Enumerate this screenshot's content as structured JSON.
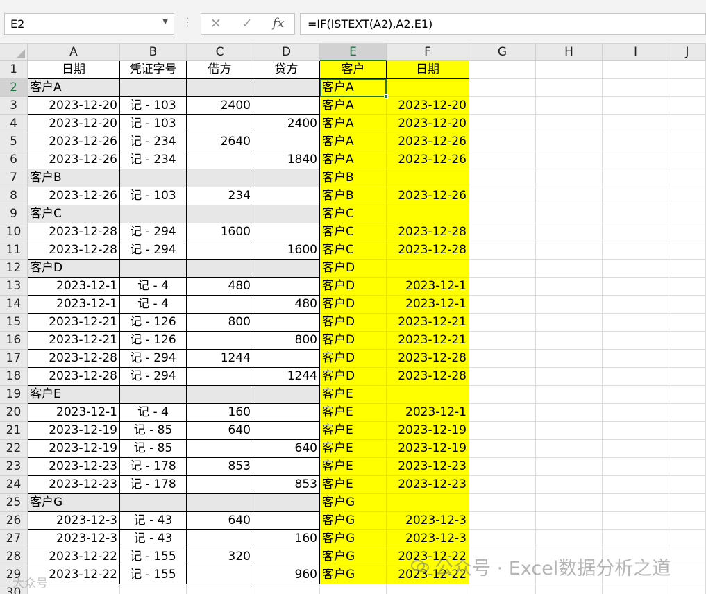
{
  "formula_bar": {
    "name_box": "E2",
    "formula": "=IF(ISTEXT(A2),A2,E1)"
  },
  "columns": [
    "A",
    "B",
    "C",
    "D",
    "E",
    "F",
    "G",
    "H",
    "I",
    "J"
  ],
  "selected_cell": "E2",
  "sheet": {
    "headers": [
      "日期",
      "凭证字号",
      "借方",
      "贷方",
      "客户",
      "日期"
    ],
    "rows": [
      {
        "row": 2,
        "group": true,
        "a": "客户A",
        "b": "",
        "c": "",
        "d": "",
        "e": "客户A",
        "f": ""
      },
      {
        "row": 3,
        "a": "2023-12-20",
        "b": "记 - 103",
        "c": "2400",
        "d": "",
        "e": "客户A",
        "f": "2023-12-20"
      },
      {
        "row": 4,
        "a": "2023-12-20",
        "b": "记 - 103",
        "c": "",
        "d": "2400",
        "e": "客户A",
        "f": "2023-12-20"
      },
      {
        "row": 5,
        "a": "2023-12-26",
        "b": "记 - 234",
        "c": "2640",
        "d": "",
        "e": "客户A",
        "f": "2023-12-26"
      },
      {
        "row": 6,
        "a": "2023-12-26",
        "b": "记 - 234",
        "c": "",
        "d": "1840",
        "e": "客户A",
        "f": "2023-12-26"
      },
      {
        "row": 7,
        "group": true,
        "a": "客户B",
        "b": "",
        "c": "",
        "d": "",
        "e": "客户B",
        "f": ""
      },
      {
        "row": 8,
        "a": "2023-12-26",
        "b": "记 - 103",
        "c": "234",
        "d": "",
        "e": "客户B",
        "f": "2023-12-26"
      },
      {
        "row": 9,
        "group": true,
        "a": "客户C",
        "b": "",
        "c": "",
        "d": "",
        "e": "客户C",
        "f": ""
      },
      {
        "row": 10,
        "a": "2023-12-28",
        "b": "记 - 294",
        "c": "1600",
        "d": "",
        "e": "客户C",
        "f": "2023-12-28"
      },
      {
        "row": 11,
        "a": "2023-12-28",
        "b": "记 - 294",
        "c": "",
        "d": "1600",
        "e": "客户C",
        "f": "2023-12-28"
      },
      {
        "row": 12,
        "group": true,
        "a": "客户D",
        "b": "",
        "c": "",
        "d": "",
        "e": "客户D",
        "f": ""
      },
      {
        "row": 13,
        "a": "2023-12-1",
        "b": "记 - 4",
        "c": "480",
        "d": "",
        "e": "客户D",
        "f": "2023-12-1"
      },
      {
        "row": 14,
        "a": "2023-12-1",
        "b": "记 - 4",
        "c": "",
        "d": "480",
        "e": "客户D",
        "f": "2023-12-1"
      },
      {
        "row": 15,
        "a": "2023-12-21",
        "b": "记 - 126",
        "c": "800",
        "d": "",
        "e": "客户D",
        "f": "2023-12-21"
      },
      {
        "row": 16,
        "a": "2023-12-21",
        "b": "记 - 126",
        "c": "",
        "d": "800",
        "e": "客户D",
        "f": "2023-12-21"
      },
      {
        "row": 17,
        "a": "2023-12-28",
        "b": "记 - 294",
        "c": "1244",
        "d": "",
        "e": "客户D",
        "f": "2023-12-28"
      },
      {
        "row": 18,
        "a": "2023-12-28",
        "b": "记 - 294",
        "c": "",
        "d": "1244",
        "e": "客户D",
        "f": "2023-12-28"
      },
      {
        "row": 19,
        "group": true,
        "a": "客户E",
        "b": "",
        "c": "",
        "d": "",
        "e": "客户E",
        "f": ""
      },
      {
        "row": 20,
        "a": "2023-12-1",
        "b": "记 - 4",
        "c": "160",
        "d": "",
        "e": "客户E",
        "f": "2023-12-1"
      },
      {
        "row": 21,
        "a": "2023-12-19",
        "b": "记 - 85",
        "c": "640",
        "d": "",
        "e": "客户E",
        "f": "2023-12-19"
      },
      {
        "row": 22,
        "a": "2023-12-19",
        "b": "记 - 85",
        "c": "",
        "d": "640",
        "e": "客户E",
        "f": "2023-12-19"
      },
      {
        "row": 23,
        "a": "2023-12-23",
        "b": "记 - 178",
        "c": "853",
        "d": "",
        "e": "客户E",
        "f": "2023-12-23"
      },
      {
        "row": 24,
        "a": "2023-12-23",
        "b": "记 - 178",
        "c": "",
        "d": "853",
        "e": "客户E",
        "f": "2023-12-23"
      },
      {
        "row": 25,
        "group": true,
        "a": "客户G",
        "b": "",
        "c": "",
        "d": "",
        "e": "客户G",
        "f": ""
      },
      {
        "row": 26,
        "a": "2023-12-3",
        "b": "记 - 43",
        "c": "640",
        "d": "",
        "e": "客户G",
        "f": "2023-12-3"
      },
      {
        "row": 27,
        "a": "2023-12-3",
        "b": "记 - 43",
        "c": "",
        "d": "160",
        "e": "客户G",
        "f": "2023-12-3"
      },
      {
        "row": 28,
        "a": "2023-12-22",
        "b": "记 - 155",
        "c": "320",
        "d": "",
        "e": "客户G",
        "f": "2023-12-22"
      },
      {
        "row": 29,
        "a": "2023-12-22",
        "b": "记 - 155",
        "c": "",
        "d": "960",
        "e": "客户G",
        "f": "2023-12-22"
      }
    ],
    "last_row_label": "30"
  },
  "watermark": {
    "text": "公众号 · Excel数据分析之道",
    "small_text": "大众号"
  }
}
